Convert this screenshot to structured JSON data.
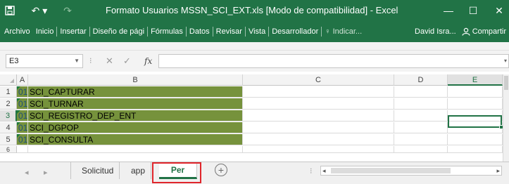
{
  "titlebar": {
    "save_icon": "save-icon",
    "undo_glyph": "↶ ▾",
    "redo_glyph": "↷",
    "title": "Formato Usuarios MSSN_SCI_EXT.xls  [Modo de compatibilidad] - Excel",
    "minimize_glyph": "—",
    "maximize_glyph": "☐",
    "close_glyph": "✕"
  },
  "ribbon": {
    "tabs": [
      "Archivo",
      "Inicio",
      "Insertar",
      "Diseño de pági",
      "Fórmulas",
      "Datos",
      "Revisar",
      "Vista",
      "Desarrollador"
    ],
    "tell_me": "Indicar...",
    "user": "David Isra...",
    "share": "Compartir"
  },
  "formula_bar": {
    "name_box": "E3",
    "cancel_glyph": "✕",
    "enter_glyph": "✓",
    "fx": "fx",
    "formula": ""
  },
  "grid": {
    "columns": [
      "A",
      "B",
      "C",
      "D",
      "E"
    ],
    "active_column": "E",
    "active_row": "3",
    "rows": [
      {
        "n": "1",
        "a": "01",
        "b": "SCI_CAPTURAR"
      },
      {
        "n": "2",
        "a": "01",
        "b": "SCI_TURNAR"
      },
      {
        "n": "3",
        "a": "01",
        "b": "SCI_REGISTRO_DEP_ENT"
      },
      {
        "n": "4",
        "a": "01",
        "b": "SCI_DGPOP"
      },
      {
        "n": "5",
        "a": "01",
        "b": "SCI_CONSULTA"
      },
      {
        "n": "6",
        "a": "",
        "b": ""
      }
    ],
    "fill_color": "#76923c"
  },
  "sheets": {
    "tabs": [
      "Solicitud",
      "app",
      "Per"
    ],
    "active": "Per",
    "add_glyph": "+"
  },
  "colors": {
    "excel_green": "#217346",
    "highlight_red": "#e0252b"
  }
}
